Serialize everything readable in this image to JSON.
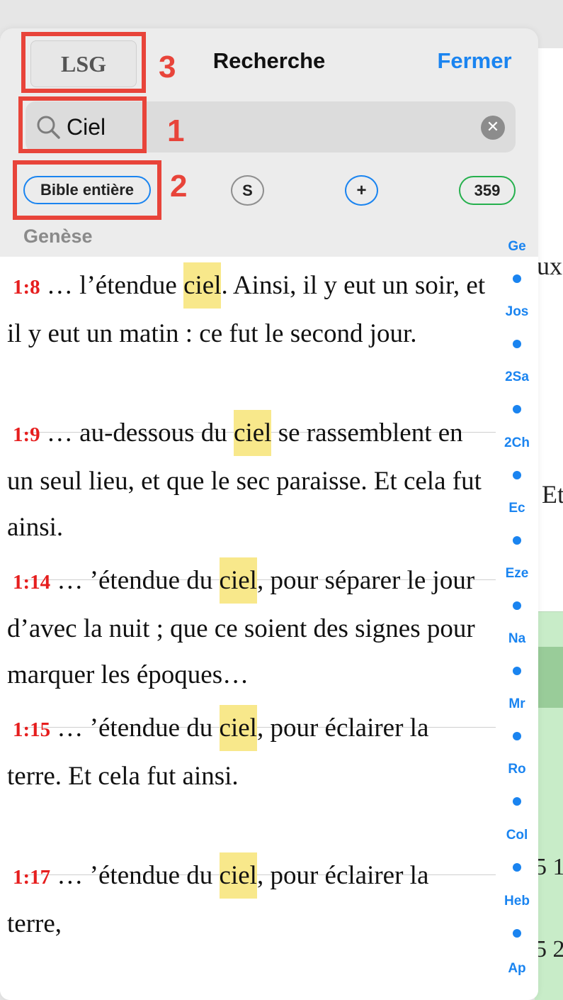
{
  "header": {
    "translation_label": "LSG",
    "title": "Recherche",
    "close_label": "Fermer"
  },
  "search": {
    "value": "Ciel",
    "placeholder": ""
  },
  "filters": {
    "scope_label": "Bible entière",
    "s_label": "S",
    "plus_label": "+",
    "result_count": "359"
  },
  "section": {
    "book": "Genèse"
  },
  "results": [
    {
      "ref": "1:8",
      "before": " … l’étendue ",
      "match": "ciel",
      "after": ". Ainsi, il y eut un soir, et il y eut un matin : ce fut le second jour."
    },
    {
      "ref": "1:9",
      "before": " … au-dessous du ",
      "match": "ciel",
      "after": " se rassemblent en un seul lieu, et que le sec paraisse. Et cela fut ainsi."
    },
    {
      "ref": "1:14",
      "before": " … ’étendue du ",
      "match": "ciel",
      "after": ", pour séparer le jour d’avec la nuit ; que ce soient des signes pour marquer les époques…"
    },
    {
      "ref": "1:15",
      "before": " … ’étendue du ",
      "match": "ciel",
      "after": ", pour éclairer la terre. Et cela fut ainsi."
    },
    {
      "ref": "1:17",
      "before": " … ’étendue du ",
      "match": "ciel",
      "after": ", pour éclairer la terre,"
    }
  ],
  "book_index": [
    "Ge",
    "Jos",
    "2Sa",
    "2Ch",
    "Ec",
    "Eze",
    "Na",
    "Mr",
    "Ro",
    "Col",
    "Heb",
    "Ap"
  ],
  "annotations": [
    "1",
    "2",
    "3"
  ],
  "background_fragments": [
    "ux",
    "Et",
    "5 1",
    "5 2"
  ],
  "colors": {
    "accent": "#1a84f0",
    "verse_ref": "#e61e1e",
    "highlight": "#f8e88b",
    "count_border": "#25b04d",
    "annotation": "#e8443a"
  }
}
